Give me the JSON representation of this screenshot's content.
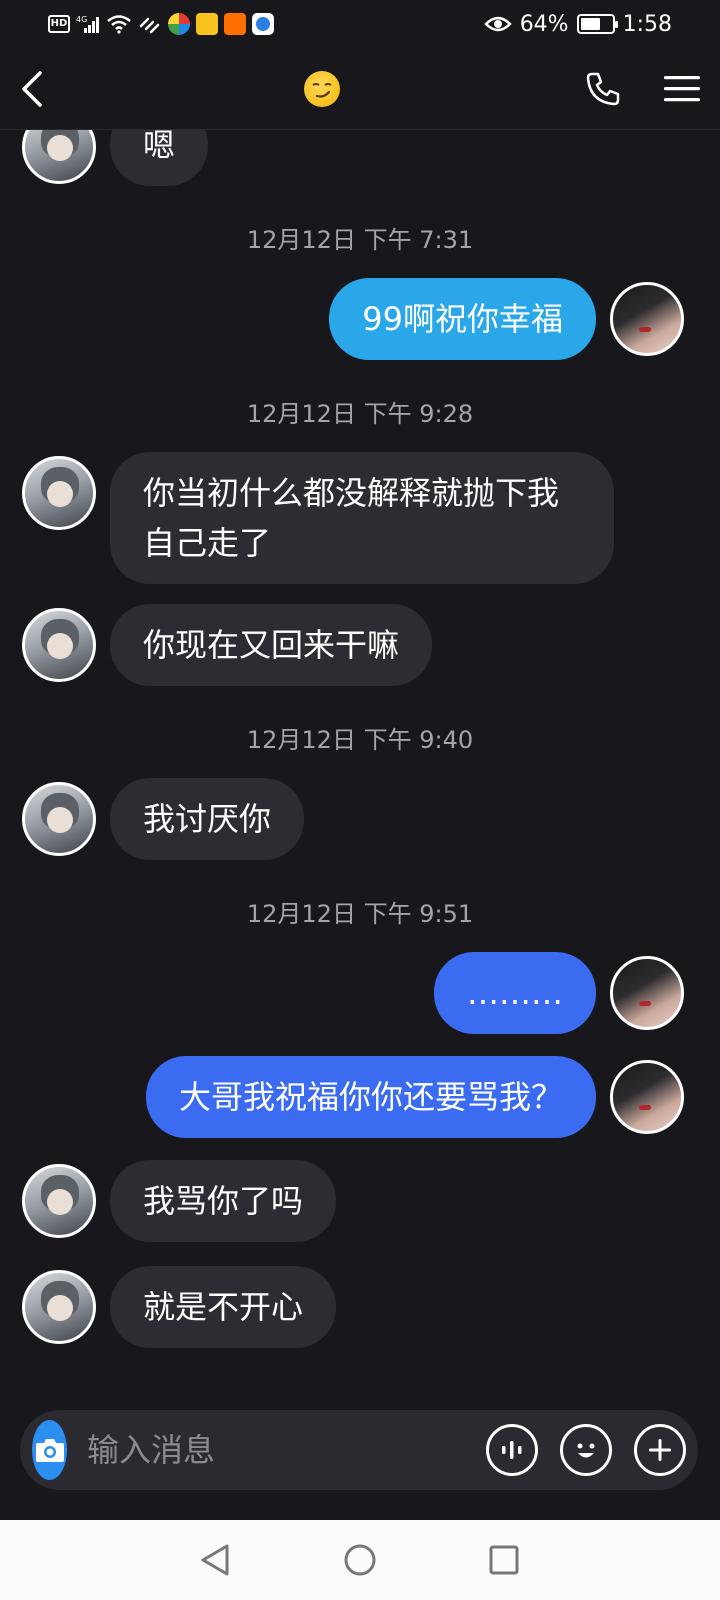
{
  "status_bar": {
    "network": "4G",
    "hd": "HD",
    "battery_percent": "64%",
    "battery_level": 0.64,
    "time": "1:58"
  },
  "header": {
    "title_emoji": "😏"
  },
  "messages": [
    {
      "type": "in",
      "text": "嗯"
    },
    {
      "type": "time",
      "text": "12月12日 下午 7:31"
    },
    {
      "type": "out",
      "text": "99啊祝你幸福"
    },
    {
      "type": "time",
      "text": "12月12日 下午 9:28"
    },
    {
      "type": "in",
      "text": "你当初什么都没解释就抛下我自己走了"
    },
    {
      "type": "in",
      "text": "你现在又回来干嘛"
    },
    {
      "type": "time",
      "text": "12月12日 下午 9:40"
    },
    {
      "type": "in",
      "text": "我讨厌你"
    },
    {
      "type": "time",
      "text": "12月12日 下午 9:51"
    },
    {
      "type": "out",
      "text": "………"
    },
    {
      "type": "out",
      "text": "大哥我祝福你你还要骂我？"
    },
    {
      "type": "in",
      "text": "我骂你了吗"
    },
    {
      "type": "in",
      "text": "就是不开心"
    }
  ],
  "composer": {
    "placeholder": "输入消息"
  },
  "colors": {
    "background": "#17171c",
    "incoming_bubble": "#2c2c32",
    "outgoing_bubble_light": "#2aa7e8",
    "outgoing_bubble": "#3a6bf0",
    "camera_button": "#2a8ff0"
  },
  "icons": {
    "back": "chevron-left-icon",
    "call": "phone-icon",
    "menu": "menu-icon",
    "camera": "camera-icon",
    "voice": "voice-wave-icon",
    "emoji": "smiley-icon",
    "more": "plus-circle-icon"
  }
}
